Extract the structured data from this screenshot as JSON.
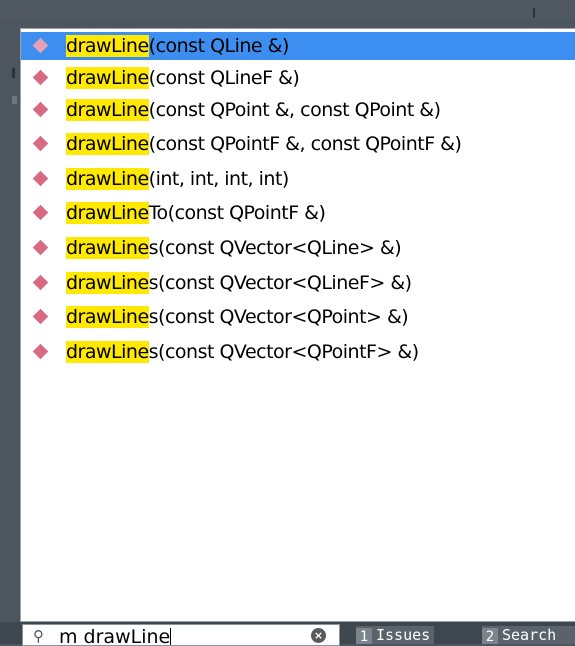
{
  "completions": [
    {
      "match": "drawLine",
      "rest": "(const QLine &)",
      "selected": true
    },
    {
      "match": "drawLine",
      "rest": "(const QLineF &)",
      "selected": false
    },
    {
      "match": "drawLine",
      "rest": "(const QPoint &, const QPoint &)",
      "selected": false
    },
    {
      "match": "drawLine",
      "rest": "(const QPointF &, const QPointF &)",
      "selected": false
    },
    {
      "match": "drawLine",
      "rest": "(int, int, int, int)",
      "selected": false
    },
    {
      "match": "drawLine",
      "rest": "To(const QPointF &)",
      "selected": false
    },
    {
      "match": "drawLine",
      "rest": "s(const QVector<QLine> &)",
      "selected": false
    },
    {
      "match": "drawLine",
      "rest": "s(const QVector<QLineF> &)",
      "selected": false
    },
    {
      "match": "drawLine",
      "rest": "s(const QVector<QPoint> &)",
      "selected": false
    },
    {
      "match": "drawLine",
      "rest": "s(const QVector<QPointF> &)",
      "selected": false
    }
  ],
  "locator": {
    "value": "m drawLine",
    "search_icon": "search-icon",
    "clear_icon": "clear-icon"
  },
  "output_panes": [
    {
      "number": "1",
      "label": "Issues"
    },
    {
      "number": "2",
      "label": "Search"
    }
  ],
  "colors": {
    "selection": "#3c8ff0",
    "highlight": "#ffe900",
    "method_icon": "#d86a84",
    "background": "#4d565e"
  }
}
